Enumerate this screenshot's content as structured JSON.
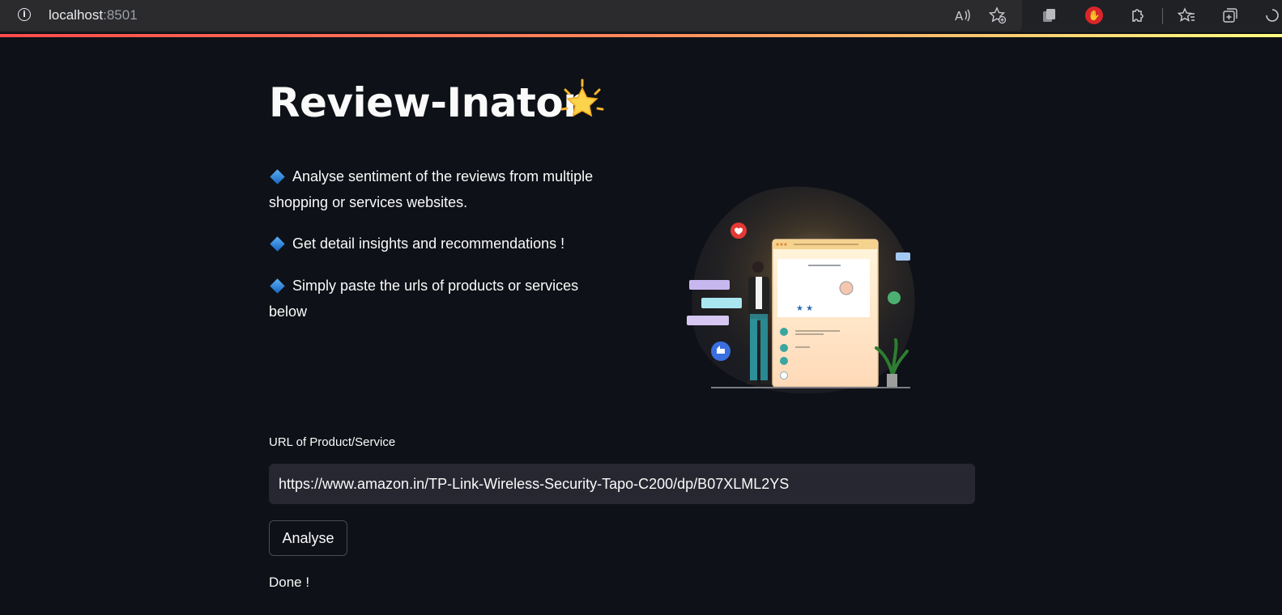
{
  "browser": {
    "url_host": "localhost",
    "url_port": ":8501"
  },
  "app": {
    "title": "Review-Inator",
    "features": [
      "Analyse sentiment of the reviews from multiple shopping or services websites.",
      "Get detail insights and recommendations !",
      "Simply paste the urls of products or services below"
    ],
    "url_field": {
      "label": "URL of Product/Service",
      "value": "https://www.amazon.in/TP-Link-Wireless-Security-Tapo-C200/dp/B07XLML2YS"
    },
    "analyse_label": "Analyse",
    "status": "Done !"
  },
  "colors": {
    "background": "#0e1117",
    "input_bg": "#262730",
    "accent": "#ff4b4b"
  },
  "icons": {
    "title_emoji": "glowing-star-icon",
    "bullet": "blue-diamond-icon"
  }
}
